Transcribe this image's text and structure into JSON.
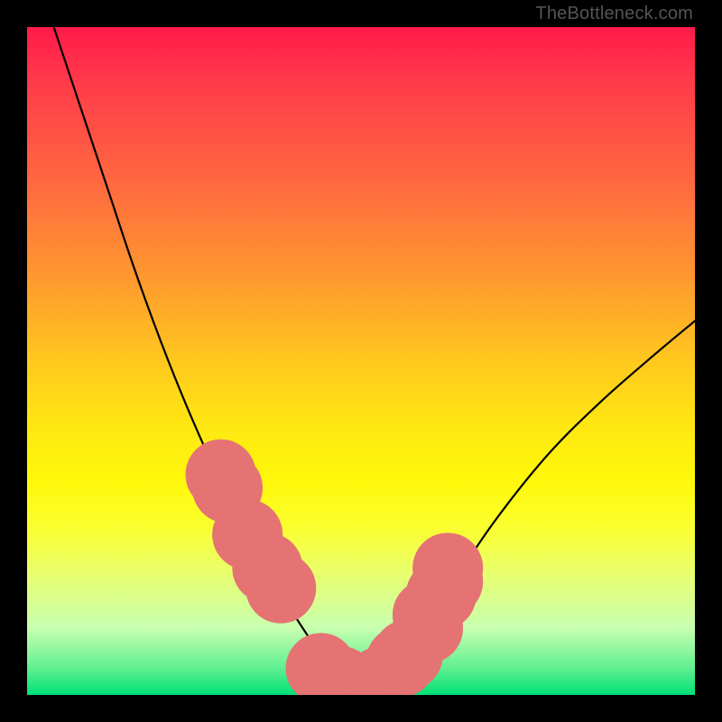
{
  "watermark": "TheBottleneck.com",
  "chart_data": {
    "type": "line",
    "title": "",
    "xlabel": "",
    "ylabel": "",
    "xlim": [
      0,
      100
    ],
    "ylim": [
      0,
      100
    ],
    "series": [
      {
        "name": "bottleneck-curve",
        "x": [
          4,
          8,
          12,
          16,
          20,
          24,
          28,
          32,
          36,
          40,
          44,
          47,
          50,
          53,
          56,
          60,
          64,
          70,
          78,
          86,
          94,
          100
        ],
        "values": [
          100,
          88,
          76,
          64,
          53,
          43,
          34,
          26,
          19,
          12,
          6,
          2,
          0,
          1,
          4,
          10,
          17,
          26,
          36,
          44,
          51,
          56
        ]
      }
    ],
    "points": {
      "name": "highlight-dots",
      "x": [
        29,
        30,
        33,
        36,
        38,
        44,
        47,
        50,
        53,
        56,
        57,
        60,
        60,
        62,
        63,
        63
      ],
      "values": [
        33,
        31,
        24,
        19,
        16,
        4,
        2,
        1,
        2,
        5,
        6,
        10,
        12,
        15,
        17,
        19
      ],
      "color": "#e57373",
      "radius": 2.2
    },
    "gradient_stops": [
      {
        "pos": 0,
        "color": "#ff1a4a"
      },
      {
        "pos": 25,
        "color": "#ff6e3e"
      },
      {
        "pos": 50,
        "color": "#ffc81e"
      },
      {
        "pos": 75,
        "color": "#fbff30"
      },
      {
        "pos": 100,
        "color": "#00e077"
      }
    ]
  }
}
